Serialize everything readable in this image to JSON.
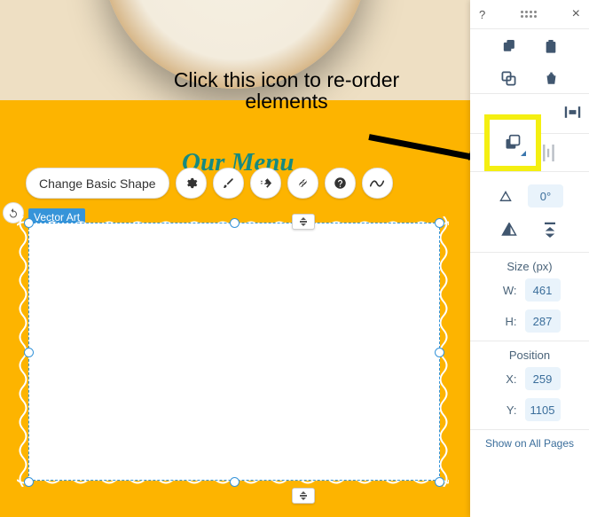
{
  "annotation": {
    "text": "Click this icon to re-order elements"
  },
  "menu_title": "Our Menu",
  "toolbar": {
    "change_shape_label": "Change Basic Shape"
  },
  "shape_tag": "Vector Art",
  "inspector": {
    "rotate_value": "0°",
    "size": {
      "title": "Size (px)",
      "w_label": "W:",
      "w_value": "461",
      "h_label": "H:",
      "h_value": "287"
    },
    "position": {
      "title": "Position",
      "x_label": "X:",
      "x_value": "259",
      "y_label": "Y:",
      "y_value": "1105"
    },
    "show_all_label": "Show on All Pages"
  }
}
